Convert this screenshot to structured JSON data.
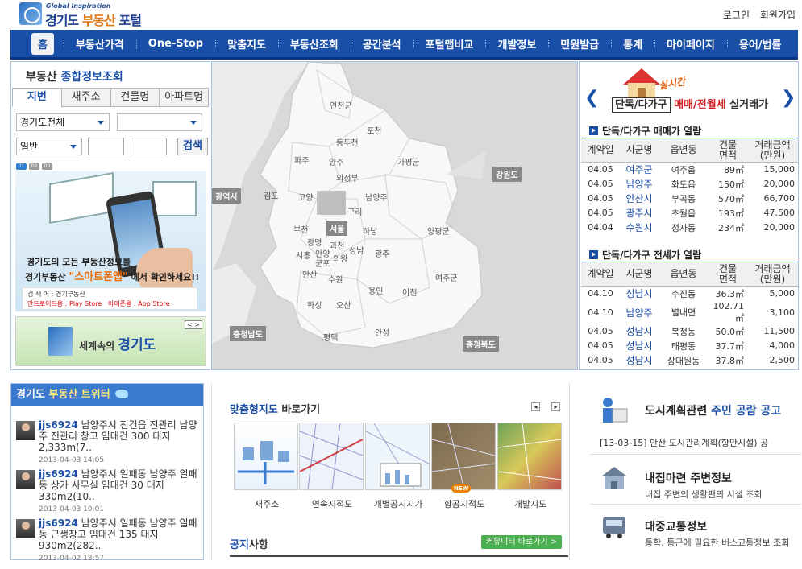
{
  "header": {
    "logo_small": "Global Inspiration",
    "logo_main_1": "경기도 ",
    "logo_main_2": "부동산",
    "logo_main_3": " 포털",
    "links": [
      "로그인",
      "회원가입"
    ]
  },
  "nav": {
    "items": [
      "홈",
      "부동산가격",
      "One-Stop",
      "맞춤지도",
      "부동산조회",
      "공간분석",
      "포털맵비교",
      "개발정보",
      "민원발급",
      "통계",
      "마이페이지",
      "용어/법률"
    ]
  },
  "search": {
    "title_1": "부동산 ",
    "title_2": "종합정보조회",
    "tabs": [
      "지번",
      "새주소",
      "건물명",
      "아파트명"
    ],
    "region_select": "경기도전체",
    "sub_select": "",
    "type_select": "일반",
    "button": "검색",
    "pages": [
      "01",
      "02",
      "03"
    ]
  },
  "banner": {
    "line1": "경기도의 모든 부동산정보를",
    "line2_a": "경기부동산 ",
    "line2_b": "\"스마트폰앱\"",
    "line2_c": " 에서 확인하세요!!",
    "info1": "검  색  어 : 경기부동산",
    "info2": "안드로이드용 : Play Store",
    "info3": "아이폰용 : App Store",
    "banner2_main": "경기도",
    "banner2_prefix": "세계속의 ",
    "banner2_nav": "< >"
  },
  "map": {
    "regions": [
      "연천군",
      "포천",
      "동두천",
      "파주",
      "양주",
      "의정부",
      "가평군",
      "김포",
      "고양",
      "남양주",
      "구리",
      "하남",
      "부천",
      "광명",
      "과천",
      "시흥",
      "안양",
      "군포",
      "의왕",
      "성남",
      "안산",
      "수원",
      "용인",
      "광주",
      "양평군",
      "이천",
      "여주군",
      "화성",
      "오산",
      "평택",
      "안성"
    ],
    "tags": [
      "서울",
      "광역시",
      "강원도",
      "충청남도",
      "충청북도"
    ]
  },
  "realprice": {
    "banner_tag": "실시간",
    "banner_box": "단독/다가구",
    "banner_red": " 매매/전월세",
    "banner_tail": " 실거래가",
    "sale_title": "단독/다가구 매매가 열람",
    "lease_title": "단독/다가구 전세가 열람",
    "headers": [
      "계약일",
      "시군명",
      "읍면동",
      "건물\n면적",
      "거래금액\n(만원)"
    ],
    "sale_rows": [
      [
        "04.05",
        "여주군",
        "여주읍",
        "89㎡",
        "15,000"
      ],
      [
        "04.05",
        "남양주",
        "화도읍",
        "150㎡",
        "20,000"
      ],
      [
        "04.05",
        "안산시",
        "부곡동",
        "570㎡",
        "66,700"
      ],
      [
        "04.05",
        "광주시",
        "초월읍",
        "193㎡",
        "47,500"
      ],
      [
        "04.04",
        "수원시",
        "정자동",
        "234㎡",
        "20,000"
      ]
    ],
    "lease_rows": [
      [
        "04.10",
        "성남시",
        "수진동",
        "36.3㎡",
        "5,000"
      ],
      [
        "04.10",
        "남양주",
        "별내면",
        "102.71㎡",
        "3,100"
      ],
      [
        "04.05",
        "성남시",
        "복정동",
        "50.0㎡",
        "11,500"
      ],
      [
        "04.05",
        "성남시",
        "태평동",
        "37.7㎡",
        "4,000"
      ],
      [
        "04.05",
        "성남시",
        "상대원동",
        "37.8㎡",
        "2,500"
      ]
    ]
  },
  "twitter": {
    "title_a": "경기도 ",
    "title_b": "부동산 트위터",
    "tweets": [
      {
        "user": "jjs6924",
        "text": " 남양주시 진건읍 진관리 남양주 진관리 창고 임대건 300 대지 2,333m(7..",
        "date": "2013-04-03 14:05"
      },
      {
        "user": "jjs6924",
        "text": " 남양주시 일패동 남양주 일패동 상가 사무실 임대건 30 대지 330m2(10..",
        "date": "2013-04-03 10:01"
      },
      {
        "user": "jjs6924",
        "text": " 남양주시 일패동 남양주 일패동 근생창고 임대건 135 대지 930m2(282..",
        "date": "2013-04-02 18:57"
      }
    ]
  },
  "custom_map": {
    "title_a": "맞춤형지도",
    "title_b": " 바로가기",
    "items": [
      "새주소",
      "연속지적도",
      "개별공시지가",
      "항공지적도",
      "개발지도"
    ],
    "new_badge": "NEW",
    "notice_a": "공지",
    "notice_b": "사항",
    "community_button": "커뮤니티 바로가기 >"
  },
  "side": {
    "block1_a": "도시계획관련 ",
    "block1_b": "주민 공람 공고",
    "notice": "[13-03-15] 안산 도시관리계획(항만시설) 공",
    "block2_title": "내집마련 주변정보",
    "block2_sub": "내집 주변의 생활편의 시설 조회",
    "block3_title": "대중교통정보",
    "block3_sub": "통학, 통근에 필요한 버스교통정보 조회"
  }
}
